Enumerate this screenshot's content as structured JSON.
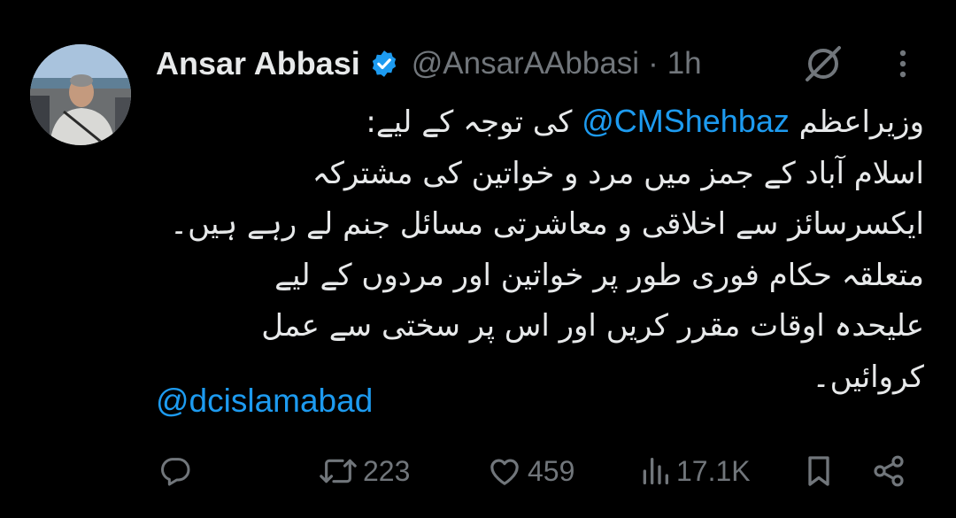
{
  "author": {
    "name": "Ansar Abbasi",
    "handle": "@AnsarAAbbasi",
    "separator": "·",
    "time": "1h",
    "verified": true
  },
  "tweet": {
    "lines": [
      {
        "before": "وزیراعظم ",
        "mention": "@CMShehbaz",
        "after": " کی توجہ کے لیے:"
      },
      {
        "text": "اسلام آباد کے جمز میں مرد و خواتین کی مشترکہ"
      },
      {
        "text": "ایکسرسائز سے اخلاقی و معاشرتی مسائل جنم لے رہے ہیں۔"
      },
      {
        "text": "متعلقہ حکام فوری طور پر خواتین اور مردوں کے لیے"
      },
      {
        "text": "علیحدہ اوقات مقرر کریں اور اس پر سختی سے عمل"
      },
      {
        "text": "کروائیں۔"
      }
    ],
    "bottom_mention": "@dcislamabad"
  },
  "actions": {
    "reply": {
      "icon": "reply-icon",
      "count": ""
    },
    "retweet": {
      "icon": "retweet-icon",
      "count": "223"
    },
    "like": {
      "icon": "heart-icon",
      "count": "459"
    },
    "views": {
      "icon": "views-icon",
      "count": "17.1K"
    },
    "bookmark": {
      "icon": "bookmark-icon"
    },
    "share": {
      "icon": "share-icon"
    }
  },
  "colors": {
    "background": "#000000",
    "text": "#e7e9ea",
    "muted": "#71767b",
    "link": "#1d9bf0"
  }
}
